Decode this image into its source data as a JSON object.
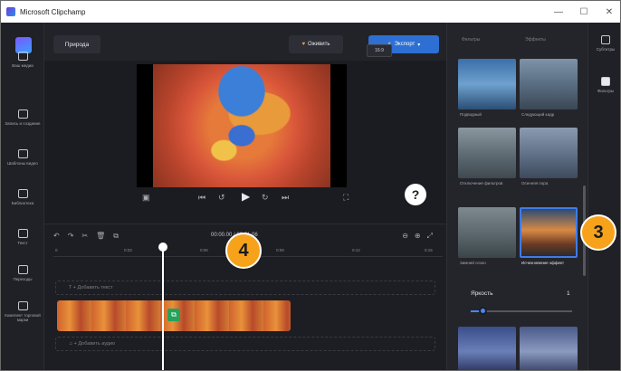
{
  "window": {
    "title": "Microsoft Clipchamp",
    "minimize": "—",
    "maximize": "☐",
    "close": "✕"
  },
  "rail": [
    {
      "label": "Ваш медиа",
      "icon": "media-icon"
    },
    {
      "label": "Запись и создание",
      "icon": "record-icon"
    },
    {
      "label": "Шаблоны видео",
      "icon": "templates-icon"
    },
    {
      "label": "Библиотека",
      "icon": "library-icon"
    },
    {
      "label": "Текст",
      "icon": "text-icon"
    },
    {
      "label": "Переходы",
      "icon": "transitions-icon"
    },
    {
      "label": "Комплект торговой марки",
      "icon": "brand-kit-icon"
    }
  ],
  "topbar": {
    "project": "Природа",
    "save": "Оживить",
    "export": "Экспорт",
    "ratio": "16:9"
  },
  "timeline": {
    "timecode": "00:00.00 / 00:31.06",
    "ruler": [
      "0",
      "0:03",
      "0:06",
      "0:09",
      "0:12",
      "0:15"
    ],
    "text_track": "T  + Добавить текст",
    "audio_track": "♫  + Добавить аудио"
  },
  "panel": {
    "tabs": [
      "Фильтры",
      "Эффекты"
    ],
    "tiles": [
      {
        "label": "Подводный"
      },
      {
        "label": "Следующий кадр"
      },
      {
        "label": "Отключение фильтров"
      },
      {
        "label": "Осенняя пора"
      },
      {
        "label": "Зимний сезон"
      },
      {
        "label": "Исчезновение эффект"
      }
    ],
    "intensity_label": "Яркость",
    "intensity_value": "1",
    "intensity": 0.12
  },
  "far_rail": [
    {
      "label": "Субтитры"
    },
    {
      "label": "Фильтры"
    }
  ],
  "callouts": {
    "three": "3",
    "four": "4"
  },
  "help": "?"
}
